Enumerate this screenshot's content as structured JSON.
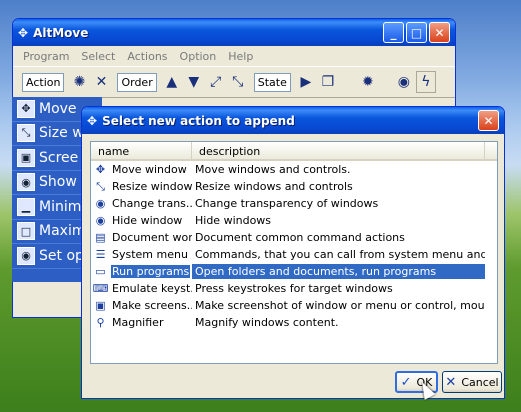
{
  "main_window": {
    "title": "AltMove",
    "menu": [
      "Program",
      "Select",
      "Actions",
      "Option",
      "Help"
    ],
    "toolbar": {
      "action_label": "Action",
      "order_label": "Order",
      "state_label": "State"
    },
    "items": [
      "Move",
      "Size wi",
      "Scree",
      "Show",
      "Minimi",
      "Maxim",
      "Set op"
    ]
  },
  "dialog": {
    "title": "Select new action to append",
    "columns": {
      "name": "name",
      "description": "description"
    },
    "rows": [
      {
        "name": "Move window",
        "description": "Move windows and controls.",
        "icon": "move-icon"
      },
      {
        "name": "Resize window",
        "description": "Resize windows and controls",
        "icon": "resize-icon"
      },
      {
        "name": "Change trans...",
        "description": "Change transparency of windows",
        "icon": "eye-icon"
      },
      {
        "name": "Hide window",
        "description": "Hide windows",
        "icon": "eye-icon"
      },
      {
        "name": "Document work",
        "description": "Document common command actions",
        "icon": "document-icon"
      },
      {
        "name": "System menu",
        "description": "Commands, that you can call from system menu and somthin...",
        "icon": "system-menu-icon"
      },
      {
        "name": "Run programs",
        "description": "Open folders and documents, run programs",
        "icon": "run-icon",
        "selected": true
      },
      {
        "name": "Emulate keyst...",
        "description": "Press keystrokes for target windows",
        "icon": "keyboard-icon"
      },
      {
        "name": "Make screens...",
        "description": "Make screenshot of window or menu or control, mouse cur...",
        "icon": "screenshot-icon"
      },
      {
        "name": "Magnifier",
        "description": "Magnify windows content.",
        "icon": "magnifier-icon"
      }
    ],
    "ok_label": "OK",
    "cancel_label": "Cancel"
  }
}
